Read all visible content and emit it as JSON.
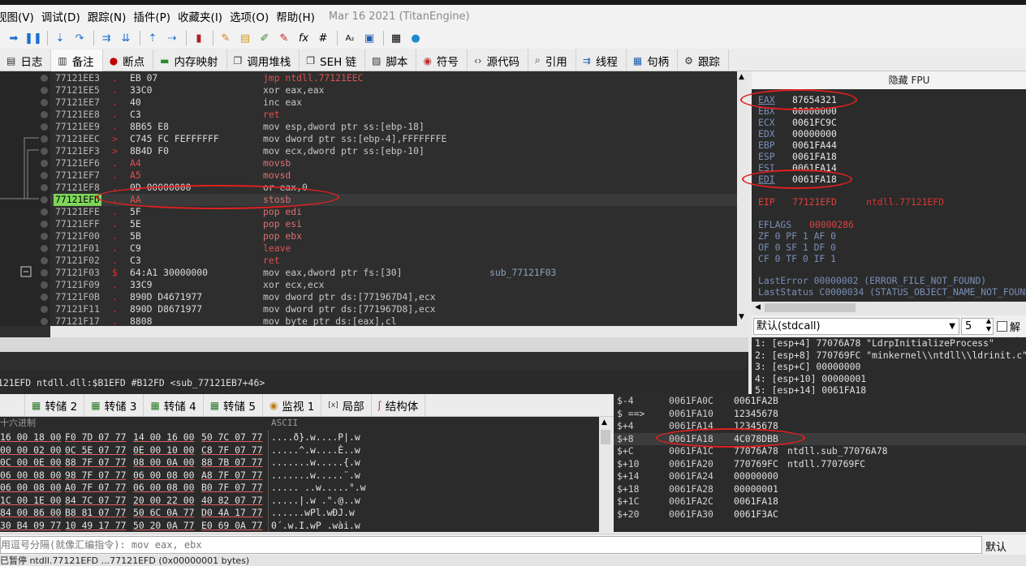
{
  "menu": [
    "视图(V)",
    "调试(D)",
    "跟踪(N)",
    "插件(P)",
    "收藏夹(I)",
    "选项(O)",
    "帮助(H)"
  ],
  "build_date": "Mar 16 2021 (TitanEngine)",
  "tabs": [
    {
      "label": "日志",
      "icon": "log-icon"
    },
    {
      "label": "备注",
      "icon": "notes-icon"
    },
    {
      "label": "断点",
      "icon": "breakpoint-icon"
    },
    {
      "label": "内存映射",
      "icon": "memory-map-icon"
    },
    {
      "label": "调用堆栈",
      "icon": "call-stack-icon"
    },
    {
      "label": "SEH 链",
      "icon": "seh-icon"
    },
    {
      "label": "脚本",
      "icon": "script-icon"
    },
    {
      "label": "符号",
      "icon": "symbols-icon"
    },
    {
      "label": "源代码",
      "icon": "source-icon"
    },
    {
      "label": "引用",
      "icon": "references-icon"
    },
    {
      "label": "线程",
      "icon": "threads-icon"
    },
    {
      "label": "句柄",
      "icon": "handles-icon"
    },
    {
      "label": "跟踪",
      "icon": "trace-icon"
    }
  ],
  "disasm": [
    {
      "addr": "77121EE3",
      "mark": ".",
      "bytes": "EB 07",
      "ins": "jmp ntdll.77121EEC",
      "cmt": ""
    },
    {
      "addr": "77121EE5",
      "mark": ".",
      "bytes": "33C0",
      "ins": "xor eax,eax",
      "cmt": ""
    },
    {
      "addr": "77121EE7",
      "mark": ".",
      "bytes": "40",
      "ins": "inc eax",
      "cmt": ""
    },
    {
      "addr": "77121EE8",
      "mark": ".",
      "bytes": "C3",
      "ins": "ret",
      "cmt": ""
    },
    {
      "addr": "77121EE9",
      "mark": ".",
      "bytes": "8B65 E8",
      "ins": "mov esp,dword ptr ss:[ebp-18]",
      "cmt": ""
    },
    {
      "addr": "77121EEC",
      "mark": ">",
      "bytes": "C745 FC FEFFFFFF",
      "ins": "mov dword ptr ss:[ebp-4],FFFFFFFE",
      "cmt": ""
    },
    {
      "addr": "77121EF3",
      "mark": ">",
      "bytes": "8B4D F0",
      "ins": "mov ecx,dword ptr ss:[ebp-10]",
      "cmt": ""
    },
    {
      "addr": "77121EF6",
      "mark": ".",
      "bytes": "A4",
      "ins": "movsb",
      "cmt": ""
    },
    {
      "addr": "77121EF7",
      "mark": ".",
      "bytes": "A5",
      "ins": "movsd",
      "cmt": ""
    },
    {
      "addr": "77121EF8",
      "mark": ".",
      "bytes": "0D 00000000",
      "ins": "or eax,0",
      "cmt": ""
    },
    {
      "addr": "77121EFD",
      "mark": ".",
      "bytes": "AA",
      "ins": "stosb",
      "cmt": "",
      "current": true
    },
    {
      "addr": "77121EFE",
      "mark": ".",
      "bytes": "5F",
      "ins": "pop edi",
      "cmt": ""
    },
    {
      "addr": "77121EFF",
      "mark": ".",
      "bytes": "5E",
      "ins": "pop esi",
      "cmt": ""
    },
    {
      "addr": "77121F00",
      "mark": ".",
      "bytes": "5B",
      "ins": "pop ebx",
      "cmt": ""
    },
    {
      "addr": "77121F01",
      "mark": ".",
      "bytes": "C9",
      "ins": "leave",
      "cmt": ""
    },
    {
      "addr": "77121F02",
      "mark": ".",
      "bytes": "C3",
      "ins": "ret",
      "cmt": ""
    },
    {
      "addr": "77121F03",
      "mark": "$",
      "bytes": "64:A1 30000000",
      "ins": "mov eax,dword ptr fs:[30]",
      "cmt": "sub_77121F03"
    },
    {
      "addr": "77121F09",
      "mark": ".",
      "bytes": "33C9",
      "ins": "xor ecx,ecx",
      "cmt": ""
    },
    {
      "addr": "77121F0B",
      "mark": ".",
      "bytes": "890D D4671977",
      "ins": "mov dword ptr ds:[771967D4],ecx",
      "cmt": ""
    },
    {
      "addr": "77121F11",
      "mark": ".",
      "bytes": "890D D8671977",
      "ins": "mov dword ptr ds:[771967D8],ecx",
      "cmt": ""
    },
    {
      "addr": "77121F17",
      "mark": ".",
      "bytes": "8808",
      "ins": "mov byte ptr ds:[eax],cl",
      "cmt": ""
    }
  ],
  "regs_header": "隐藏 FPU",
  "registers": [
    {
      "name": "EAX",
      "value": "87654321"
    },
    {
      "name": "EBX",
      "value": "00000000"
    },
    {
      "name": "ECX",
      "value": "0061FC9C"
    },
    {
      "name": "EDX",
      "value": "00000000"
    },
    {
      "name": "EBP",
      "value": "0061FA44"
    },
    {
      "name": "ESP",
      "value": "0061FA18"
    },
    {
      "name": "ESI",
      "value": "0061FA14"
    },
    {
      "name": "EDI",
      "value": "0061FA18"
    }
  ],
  "eip": {
    "name": "EIP",
    "value": "77121EFD",
    "extra": "ntdll.77121EFD"
  },
  "eflags": {
    "name": "EFLAGS",
    "value": "00000286"
  },
  "flags": [
    "ZF 0  PF 1  AF 0",
    "OF 0  SF 1  DF 0",
    "CF 0  TF 0  IF 1"
  ],
  "last_error": "LastError  00000002 (ERROR_FILE_NOT_FOUND)",
  "last_status": "LastStatus C0000034 (STATUS_OBJECT_NAME_NOT_FOUND)",
  "callconv": {
    "selected": "默认(stdcall)",
    "count": "5",
    "unlock": "解锁"
  },
  "args": [
    "1: [esp+4] 77076A78 \"LdrpInitializeProcess\"",
    "2: [esp+8] 770769FC \"minkernel\\\\ntdll\\\\ldrinit.c\"",
    "3: [esp+C] 00000000",
    "4: [esp+10] 00000001",
    "5: [esp+14] 0061FA18"
  ],
  "info_line": "121EFD ntdll.dll:$B1EFD #B12FD <sub_77121EB7+46>",
  "dump_tabs": [
    {
      "label": "转储 2",
      "icon": "dump-icon"
    },
    {
      "label": "转储 3",
      "icon": "dump-icon"
    },
    {
      "label": "转储 4",
      "icon": "dump-icon"
    },
    {
      "label": "转储 5",
      "icon": "dump-icon"
    },
    {
      "label": "监视 1",
      "icon": "watch-icon"
    },
    {
      "label": "局部",
      "icon": "locals-icon"
    },
    {
      "label": "结构体",
      "icon": "struct-icon"
    }
  ],
  "dump_headers": {
    "hex": "十六进制",
    "ascii": "ASCII"
  },
  "dump_rows": [
    {
      "h": [
        "16 00 18 00",
        "F0 7D 07 77",
        "14 00 16 00",
        "50 7C 07 77"
      ],
      "a": "....ð}.w....P|.w"
    },
    {
      "h": [
        "00 00 02 00",
        "0C 5E 07 77",
        "0E 00 10 00",
        "C8 7F 07 77"
      ],
      "a": ".....^.w....È..w"
    },
    {
      "h": [
        "0C 00 0E 00",
        "88 7F 07 77",
        "08 00 0A 00",
        "88 7B 07 77"
      ],
      "a": ".......w.....{.w"
    },
    {
      "h": [
        "06 00 08 00",
        "98 7F 07 77",
        "06 00 08 00",
        "A8 7F 07 77"
      ],
      "a": ".......w.....¨.w"
    },
    {
      "h": [
        "06 00 08 00",
        "A0 7F 07 77",
        "06 00 08 00",
        "B0 7F 07 77"
      ],
      "a": "..... ..w.....°.w"
    },
    {
      "h": [
        "1C 00 1E 00",
        "84 7C 07 77",
        "20 00 22 00",
        "40 82 07 77"
      ],
      "a": ".....|.w .\".@..w"
    },
    {
      "h": [
        "84 00 86 00",
        "B8 81 07 77",
        "50 6C 0A 77",
        "D0 4A 17 77"
      ],
      "a": "......wPl.wÐJ.w"
    },
    {
      "h": [
        "30 B4 09 77",
        "10 49 17 77",
        "50 20 0A 77",
        "E0 69 0A 77"
      ],
      "a": "0´.w.I.wP .wài.w"
    }
  ],
  "stack_rows": [
    {
      "off": "$-4",
      "addr": "0061FA0C",
      "val": "0061FA2B",
      "cmt": ""
    },
    {
      "off": "$ ==>",
      "addr": "0061FA10",
      "val": "12345678",
      "cmt": ""
    },
    {
      "off": "$+4",
      "addr": "0061FA14",
      "val": "12345678",
      "cmt": ""
    },
    {
      "off": "$+8",
      "addr": "0061FA18",
      "val": "4C078DBB",
      "cmt": "",
      "hl": true
    },
    {
      "off": "$+C",
      "addr": "0061FA1C",
      "val": "77076A78",
      "cmt": "ntdll.sub_77076A78"
    },
    {
      "off": "$+10",
      "addr": "0061FA20",
      "val": "770769FC",
      "cmt": "ntdll.770769FC"
    },
    {
      "off": "$+14",
      "addr": "0061FA24",
      "val": "00000000",
      "cmt": ""
    },
    {
      "off": "$+18",
      "addr": "0061FA28",
      "val": "00000001",
      "cmt": ""
    },
    {
      "off": "$+1C",
      "addr": "0061FA2C",
      "val": "0061FA18",
      "cmt": ""
    },
    {
      "off": "$+20",
      "addr": "0061FA30",
      "val": "0061F3AC",
      "cmt": ""
    }
  ],
  "command": {
    "placeholder": "用逗号分隔(就像汇编指令): mov eax, ebx",
    "default_label": "默认"
  },
  "status": "已暂停  ntdll.77121EFD  ...77121EFD (0x00000001 bytes)"
}
